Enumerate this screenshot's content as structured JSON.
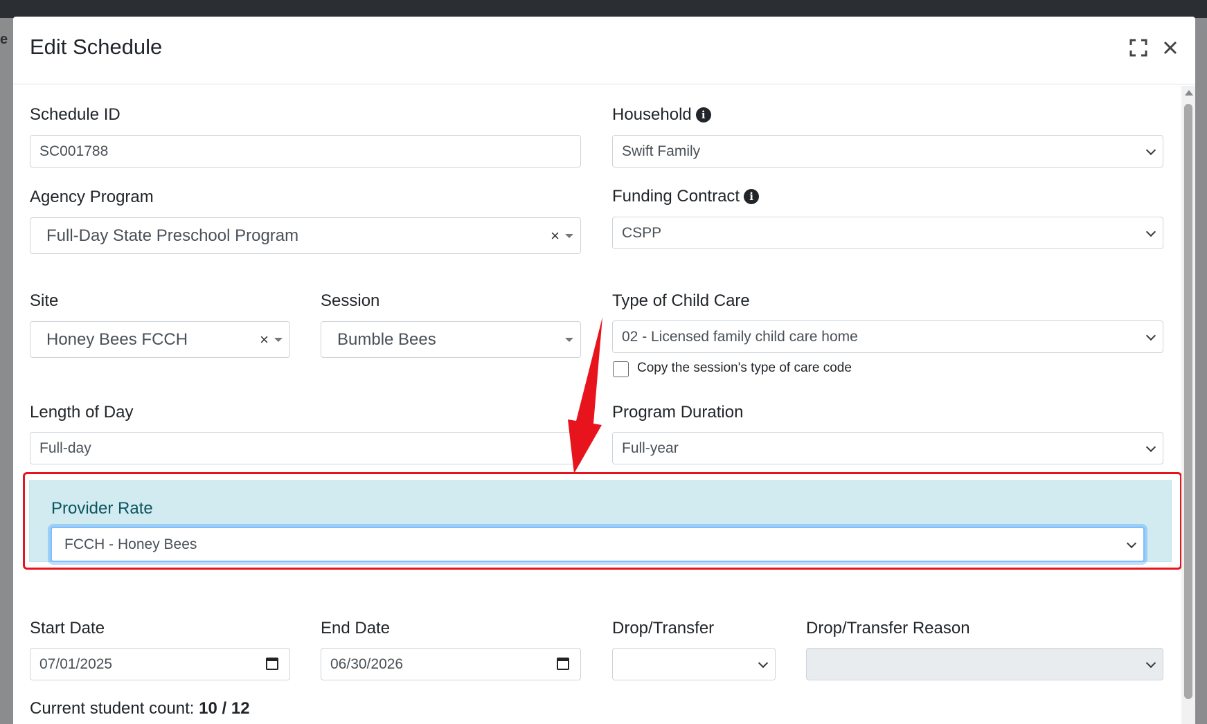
{
  "modal": {
    "title": "Edit Schedule",
    "expand_icon": "expand-icon",
    "close_icon": "close-icon"
  },
  "form": {
    "schedule_id": {
      "label": "Schedule ID",
      "value": "SC001788"
    },
    "household": {
      "label": "Household",
      "value": "Swift Family"
    },
    "agency_program": {
      "label": "Agency Program",
      "value": "Full-Day State Preschool Program"
    },
    "funding_contract": {
      "label": "Funding Contract",
      "value": "CSPP"
    },
    "site": {
      "label": "Site",
      "value": "Honey Bees FCCH"
    },
    "session": {
      "label": "Session",
      "value": "Bumble Bees"
    },
    "type_of_child_care": {
      "label": "Type of Child Care",
      "value": "02 - Licensed family child care home"
    },
    "copy_session_code": {
      "label": "Copy the session's type of care code",
      "checked": false
    },
    "length_of_day": {
      "label": "Length of Day",
      "value": "Full-day"
    },
    "program_duration": {
      "label": "Program Duration",
      "value": "Full-year"
    },
    "provider_rate": {
      "label": "Provider Rate",
      "value": "FCCH - Honey Bees"
    },
    "start_date": {
      "label": "Start Date",
      "value": "07/01/2025"
    },
    "end_date": {
      "label": "End Date",
      "value": "06/30/2026"
    },
    "drop_transfer": {
      "label": "Drop/Transfer",
      "value": ""
    },
    "drop_transfer_reason": {
      "label": "Drop/Transfer Reason",
      "value": ""
    }
  },
  "student_count": {
    "label": "Current student count:",
    "value": "10 / 12"
  },
  "annotation": {
    "highlight_color": "#e8141d",
    "arrow_color": "#e8141d"
  },
  "colors": {
    "panel_bg": "#d1ebf0",
    "panel_text": "#0c5460",
    "focus_border": "#80bdff"
  }
}
